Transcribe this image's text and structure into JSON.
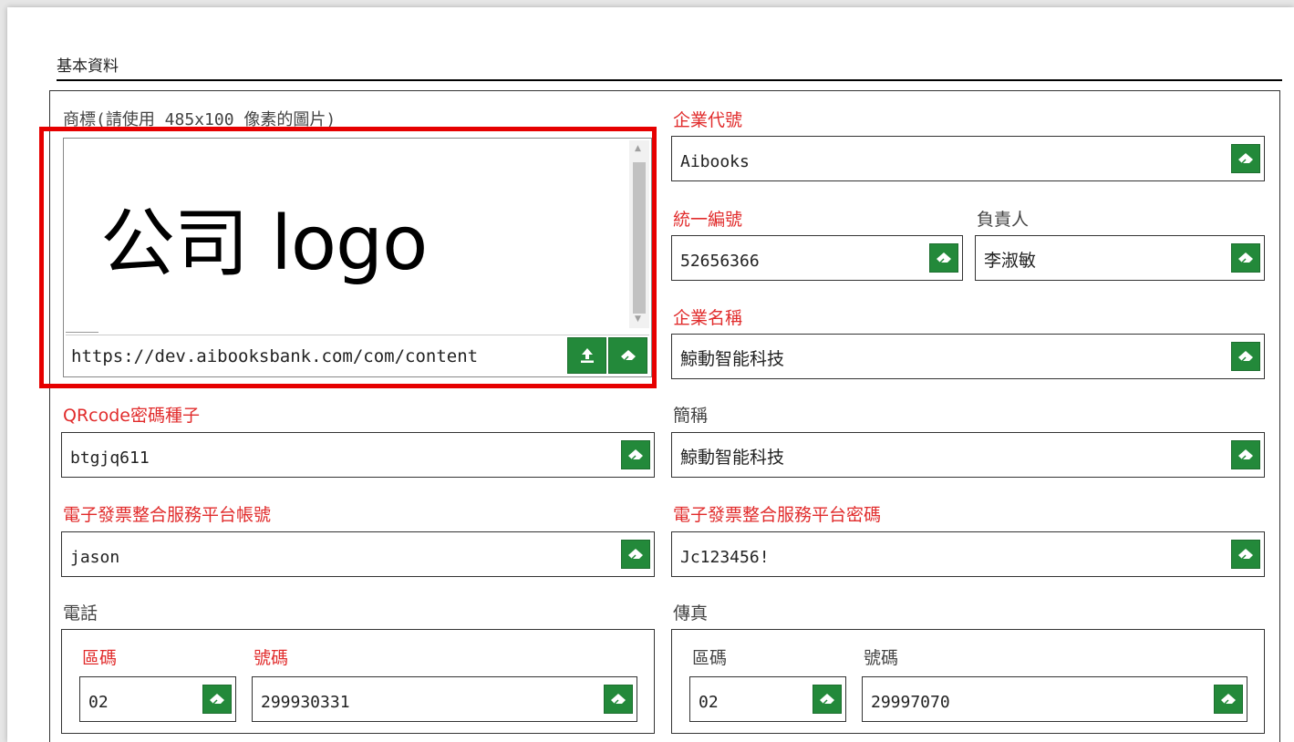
{
  "section": {
    "title": "基本資料"
  },
  "logo": {
    "label": "商標(請使用 485x100 像素的圖片)",
    "image_text": "公司 logo",
    "url": "https://dev.aibooksbank.com/com/content"
  },
  "fields": {
    "company_code": {
      "label": "企業代號",
      "value": "Aibooks"
    },
    "tax_id": {
      "label": "統一編號",
      "value": "52656366"
    },
    "owner": {
      "label": "負責人",
      "value": "李淑敏"
    },
    "company_name": {
      "label": "企業名稱",
      "value": "鯨動智能科技"
    },
    "short_name": {
      "label": "簡稱",
      "value": "鯨動智能科技"
    },
    "qrcode_seed": {
      "label": "QRcode密碼種子",
      "value": "btgjq611"
    },
    "einvoice_account": {
      "label": "電子發票整合服務平台帳號",
      "value": "jason"
    },
    "einvoice_password": {
      "label": "電子發票整合服務平台密碼",
      "value": "Jc123456!"
    }
  },
  "phone": {
    "label": "電話",
    "area_label": "區碼",
    "number_label": "號碼",
    "area": "02",
    "number": "299930331"
  },
  "fax": {
    "label": "傳真",
    "area_label": "區碼",
    "number_label": "號碼",
    "area": "02",
    "number": "29997070"
  },
  "colors": {
    "required": "#e12c2c",
    "button": "#23893a",
    "highlight": "#e60000"
  },
  "icons": {
    "clear": "eraser-icon",
    "upload": "upload-icon"
  }
}
